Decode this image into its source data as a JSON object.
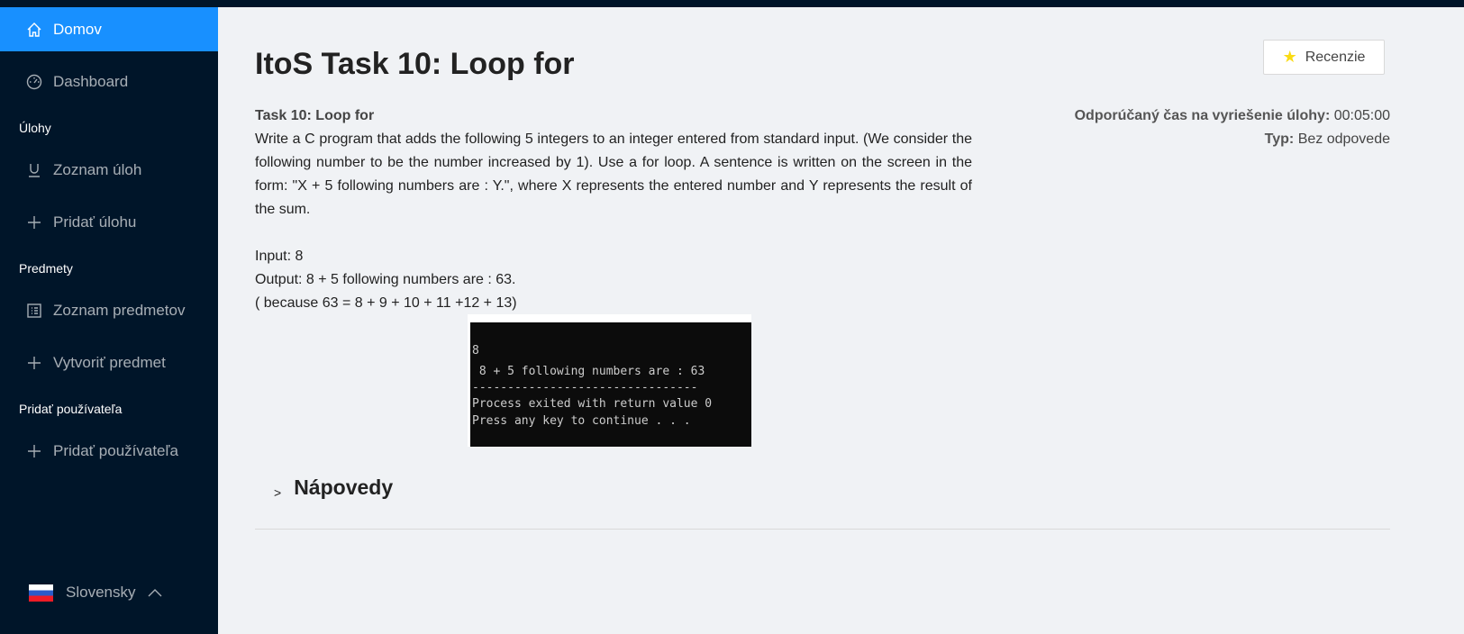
{
  "sidebar": {
    "items": [
      {
        "label": "Domov",
        "icon": "home-icon"
      },
      {
        "label": "Dashboard",
        "icon": "dashboard-icon"
      }
    ],
    "groups": [
      {
        "title": "Úlohy",
        "items": [
          {
            "label": "Zoznam úloh",
            "icon": "underline-icon"
          },
          {
            "label": "Pridať úlohu",
            "icon": "plus-icon"
          }
        ]
      },
      {
        "title": "Predmety",
        "items": [
          {
            "label": "Zoznam predmetov",
            "icon": "list-icon"
          },
          {
            "label": "Vytvoriť predmet",
            "icon": "plus-icon"
          }
        ]
      },
      {
        "title": "Pridať používateľa",
        "items": [
          {
            "label": "Pridať používateľa",
            "icon": "plus-icon"
          }
        ]
      }
    ],
    "language": "Slovensky"
  },
  "main": {
    "title": "ItoS Task 10: Loop for",
    "review_button": "Recenzie",
    "meta": {
      "time_label": "Odporúčaný čas na vyriešenie úlohy:",
      "time_value": "00:05:00",
      "type_label": "Typ:",
      "type_value": "Bez odpovede"
    },
    "task": {
      "heading": "Task 10: Loop for",
      "text": "Write a C program that adds the following 5 integers to an integer entered from standard input. (We consider the following number to be the number increased by 1). Use a for loop. A sentence is written on the screen in the form: \"X + 5 following numbers are : Y.\", where X represents the entered number and Y represents the result of the sum.",
      "input": "Input: 8",
      "output": "Output: 8 + 5 following numbers are : 63.",
      "because": "( because 63 = 8 + 9 + 10 + 11 +12 + 13)"
    },
    "terminal": [
      "8",
      "",
      "",
      " 8 + 5 following numbers are : 63",
      "--------------------------------",
      "Process exited with return value 0",
      "Press any key to continue . . ."
    ],
    "hints_title": "Nápovedy"
  },
  "colors": {
    "accent": "#1890ff",
    "sidebar": "#001529",
    "background": "#f0f2f5"
  }
}
